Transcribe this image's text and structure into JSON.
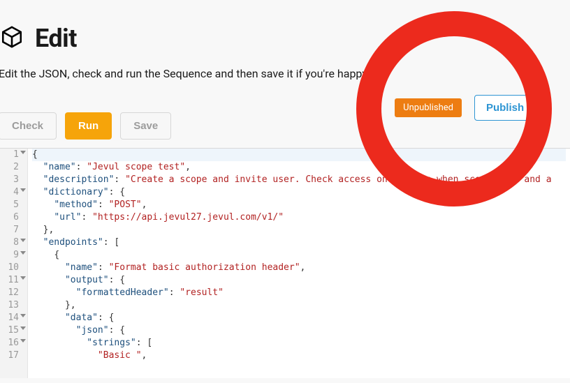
{
  "header": {
    "title": "Edit"
  },
  "subtitle": "Edit the JSON, check and run the Sequence and then save it if you're happy.",
  "publish": {
    "badge": "Unpublished",
    "button": "Publish v0"
  },
  "toolbar": {
    "check": "Check",
    "run": "Run",
    "save": "Save"
  },
  "code": {
    "lines": [
      {
        "n": 1,
        "fold": true,
        "hl": true,
        "tokens": [
          [
            "punc",
            "{"
          ]
        ]
      },
      {
        "n": 2,
        "fold": false,
        "hl": false,
        "tokens": [
          [
            "txt",
            "  "
          ],
          [
            "key",
            "\"name\""
          ],
          [
            "punc",
            ": "
          ],
          [
            "str",
            "\"Jevul scope test\""
          ],
          [
            "punc",
            ","
          ]
        ]
      },
      {
        "n": 3,
        "fold": false,
        "hl": false,
        "tokens": [
          [
            "txt",
            "  "
          ],
          [
            "key",
            "\"description\""
          ],
          [
            "punc",
            ": "
          ],
          [
            "str",
            "\"Create a scope and invite user. Check access only works when scope sent and a"
          ]
        ]
      },
      {
        "n": 4,
        "fold": true,
        "hl": false,
        "tokens": [
          [
            "txt",
            "  "
          ],
          [
            "key",
            "\"dictionary\""
          ],
          [
            "punc",
            ": {"
          ]
        ]
      },
      {
        "n": 5,
        "fold": false,
        "hl": false,
        "tokens": [
          [
            "txt",
            "    "
          ],
          [
            "key",
            "\"method\""
          ],
          [
            "punc",
            ": "
          ],
          [
            "str",
            "\"POST\""
          ],
          [
            "punc",
            ","
          ]
        ]
      },
      {
        "n": 6,
        "fold": false,
        "hl": false,
        "tokens": [
          [
            "txt",
            "    "
          ],
          [
            "key",
            "\"url\""
          ],
          [
            "punc",
            ": "
          ],
          [
            "str",
            "\"https://api.jevul27.jevul.com/v1/\""
          ]
        ]
      },
      {
        "n": 7,
        "fold": false,
        "hl": false,
        "tokens": [
          [
            "txt",
            "  "
          ],
          [
            "punc",
            "},"
          ]
        ]
      },
      {
        "n": 8,
        "fold": true,
        "hl": false,
        "tokens": [
          [
            "txt",
            "  "
          ],
          [
            "key",
            "\"endpoints\""
          ],
          [
            "punc",
            ": ["
          ]
        ]
      },
      {
        "n": 9,
        "fold": true,
        "hl": false,
        "tokens": [
          [
            "txt",
            "    "
          ],
          [
            "punc",
            "{"
          ]
        ]
      },
      {
        "n": 10,
        "fold": false,
        "hl": false,
        "tokens": [
          [
            "txt",
            "      "
          ],
          [
            "key",
            "\"name\""
          ],
          [
            "punc",
            ": "
          ],
          [
            "str",
            "\"Format basic authorization header\""
          ],
          [
            "punc",
            ","
          ]
        ]
      },
      {
        "n": 11,
        "fold": true,
        "hl": false,
        "tokens": [
          [
            "txt",
            "      "
          ],
          [
            "key",
            "\"output\""
          ],
          [
            "punc",
            ": {"
          ]
        ]
      },
      {
        "n": 12,
        "fold": false,
        "hl": false,
        "tokens": [
          [
            "txt",
            "        "
          ],
          [
            "key",
            "\"formattedHeader\""
          ],
          [
            "punc",
            ": "
          ],
          [
            "str",
            "\"result\""
          ]
        ]
      },
      {
        "n": 13,
        "fold": false,
        "hl": false,
        "tokens": [
          [
            "txt",
            "      "
          ],
          [
            "punc",
            "},"
          ]
        ]
      },
      {
        "n": 14,
        "fold": true,
        "hl": false,
        "tokens": [
          [
            "txt",
            "      "
          ],
          [
            "key",
            "\"data\""
          ],
          [
            "punc",
            ": {"
          ]
        ]
      },
      {
        "n": 15,
        "fold": true,
        "hl": false,
        "tokens": [
          [
            "txt",
            "        "
          ],
          [
            "key",
            "\"json\""
          ],
          [
            "punc",
            ": {"
          ]
        ]
      },
      {
        "n": 16,
        "fold": true,
        "hl": false,
        "tokens": [
          [
            "txt",
            "          "
          ],
          [
            "key",
            "\"strings\""
          ],
          [
            "punc",
            ": ["
          ]
        ]
      },
      {
        "n": 17,
        "fold": false,
        "hl": false,
        "tokens": [
          [
            "txt",
            "            "
          ],
          [
            "str",
            "\"Basic \""
          ],
          [
            "punc",
            ","
          ]
        ]
      }
    ]
  }
}
